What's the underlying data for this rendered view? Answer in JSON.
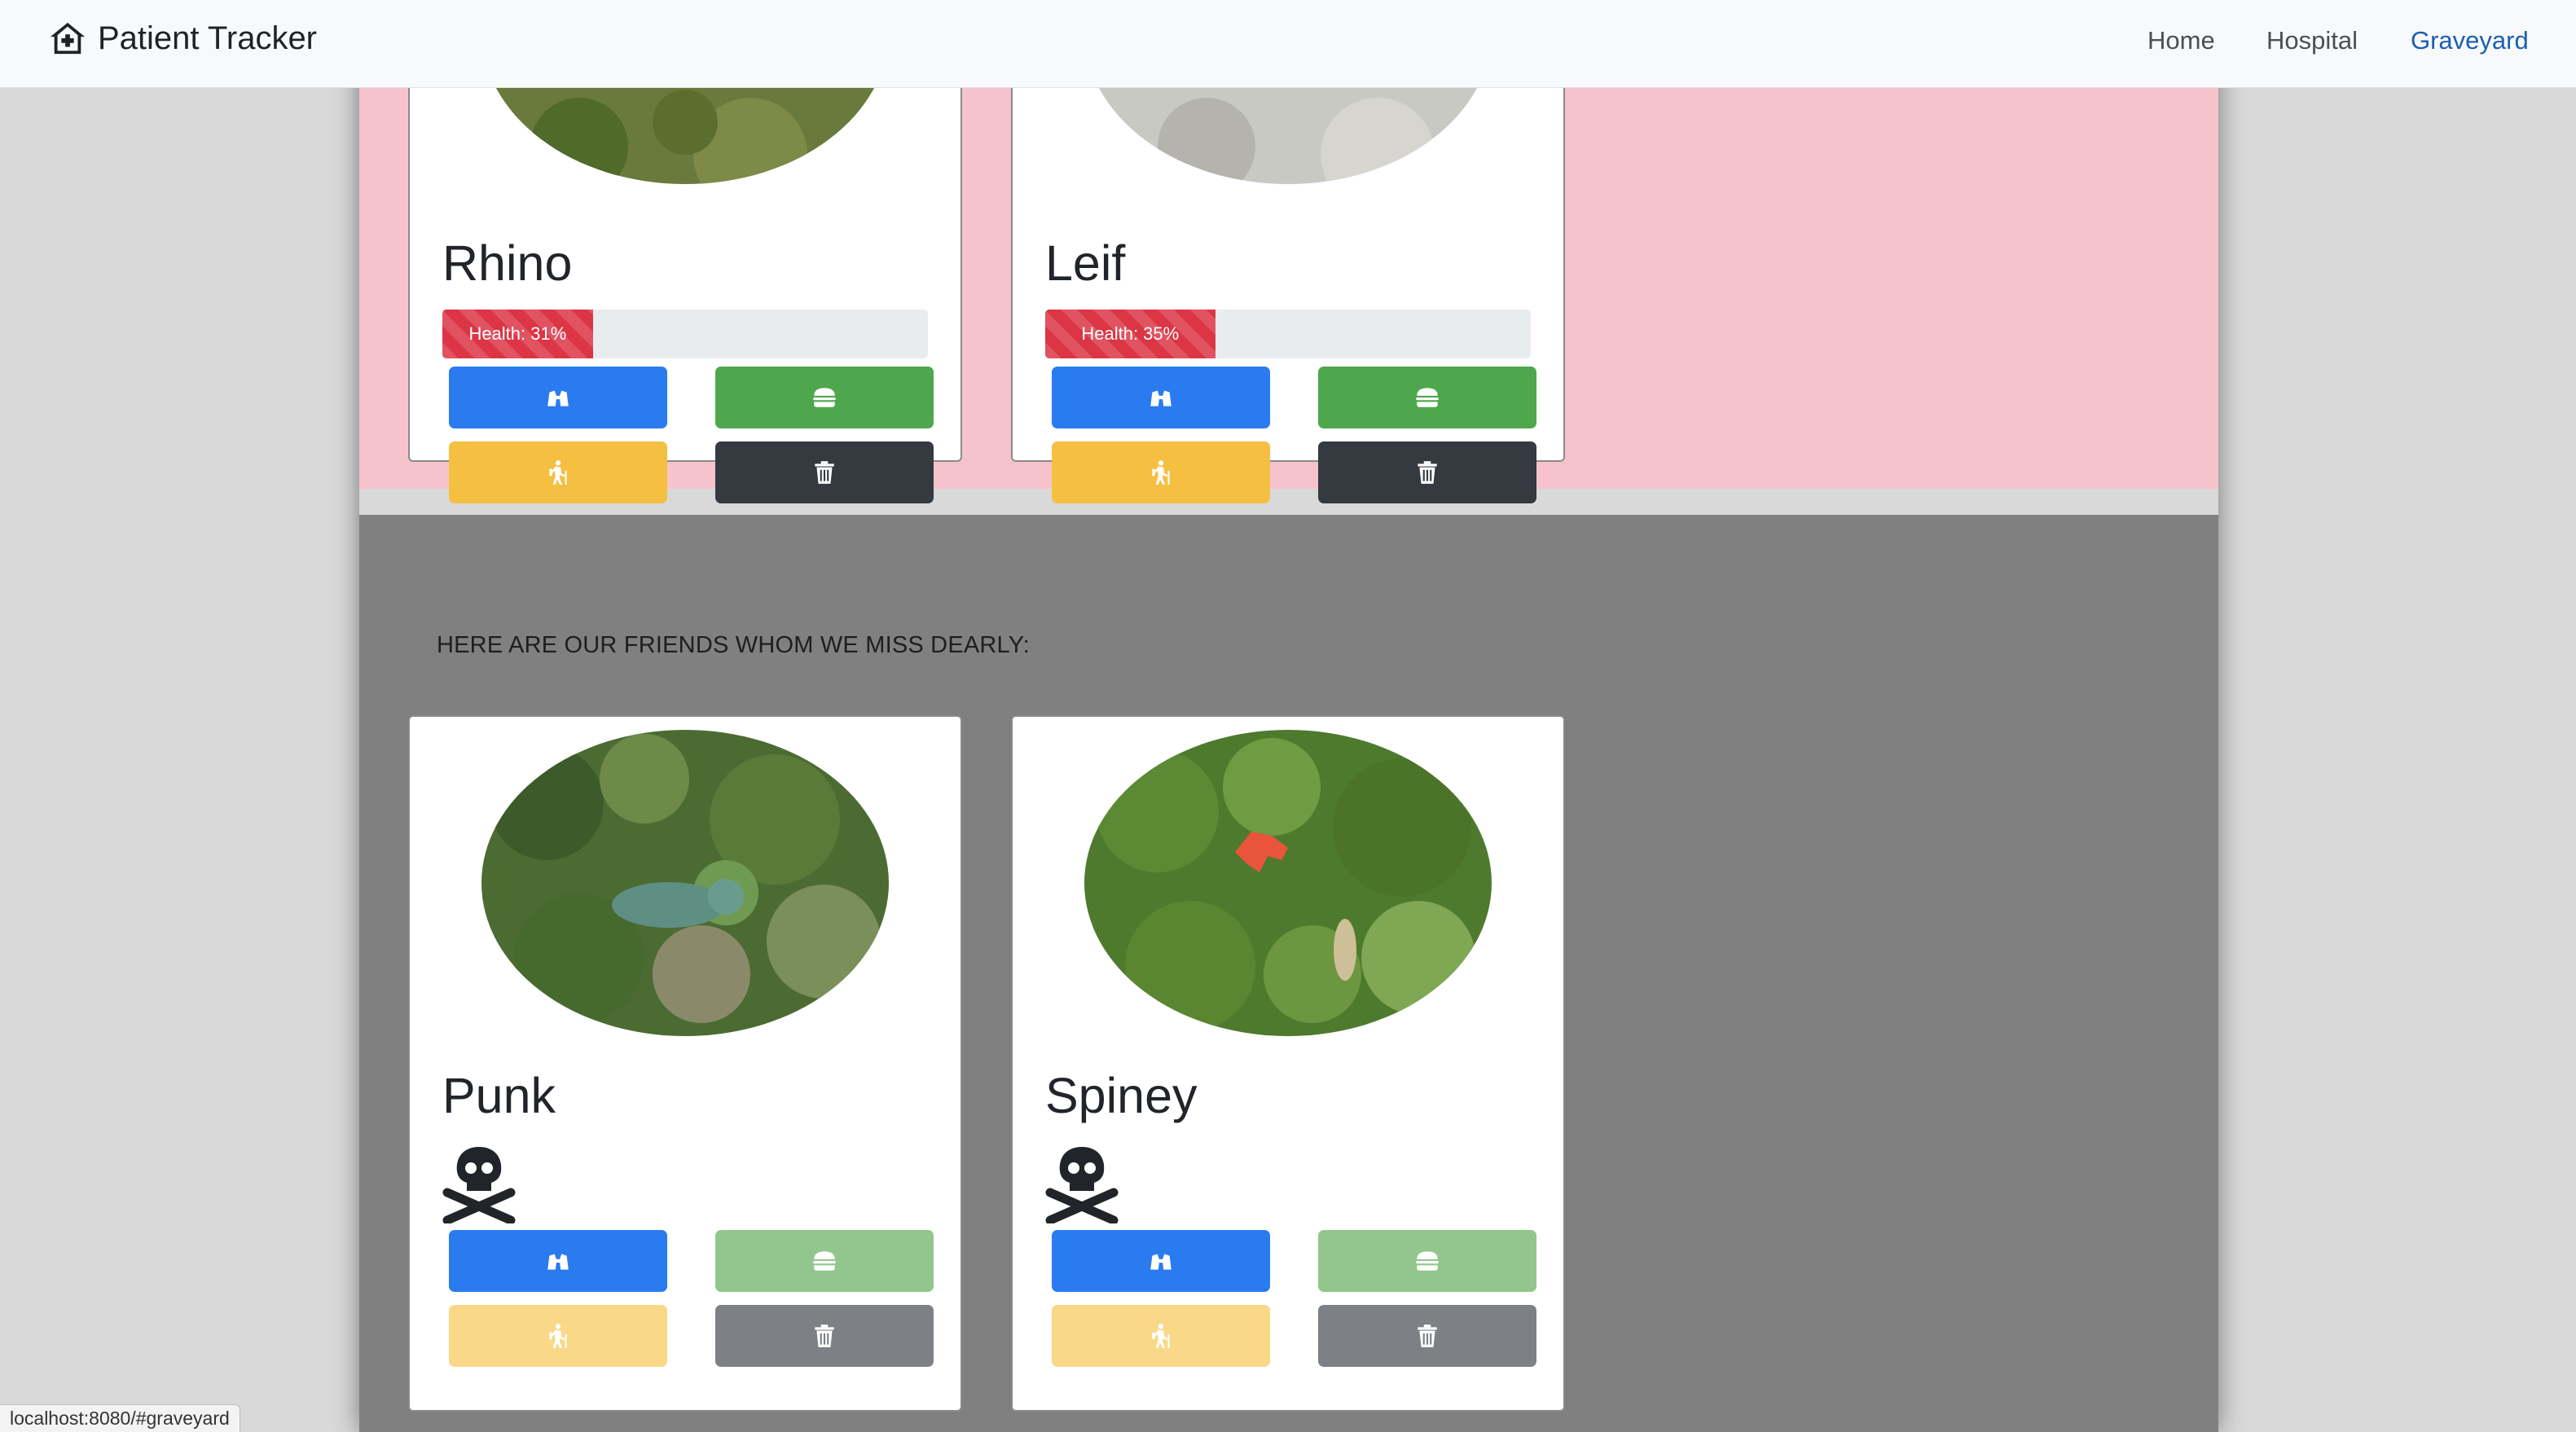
{
  "navbar": {
    "brand": "Patient Tracker",
    "links": [
      "Home",
      "Hospital",
      "Graveyard"
    ],
    "active": "Graveyard"
  },
  "hospital": {
    "patients": [
      {
        "name": "Rhino",
        "health_label": "Health: 31%",
        "health": 31
      },
      {
        "name": "Leif",
        "health_label": "Health: 35%",
        "health": 35
      }
    ]
  },
  "graveyard": {
    "heading": "HERE ARE OUR FRIENDS WHOM WE MISS DEARLY:",
    "pets": [
      {
        "name": "Punk"
      },
      {
        "name": "Spiney"
      }
    ]
  },
  "actions": [
    "binoculars-icon",
    "hamburger-icon",
    "hiking-icon",
    "trash-icon"
  ],
  "colors": {
    "hospital_bg": "#f6c3cc",
    "graveyard_bg": "#808080",
    "primary": "#2b7bf0",
    "success": "#4ea74d",
    "warning": "#f5bf42",
    "dark": "#343a40",
    "danger": "#dc3545"
  },
  "status_bar": {
    "url": "localhost:8080/#graveyard"
  }
}
